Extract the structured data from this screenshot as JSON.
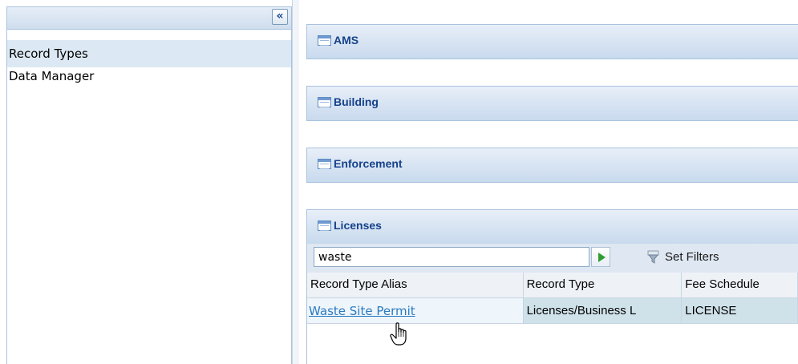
{
  "sidebar": {
    "collapse_glyph": "«",
    "items": [
      {
        "label": "Record Types",
        "selected": true
      },
      {
        "label": "Data Manager",
        "selected": false
      }
    ]
  },
  "sections": [
    {
      "title": "AMS",
      "icon": "panel-icon"
    },
    {
      "title": "Building",
      "icon": "panel-icon"
    },
    {
      "title": "Enforcement",
      "icon": "panel-icon"
    },
    {
      "title": "Licenses",
      "icon": "panel-icon"
    }
  ],
  "licenses": {
    "search_value": "waste",
    "go_icon": "play-arrow-icon",
    "filter_icon": "filter-icon",
    "set_filters_label": "Set Filters",
    "columns": [
      "Record Type Alias",
      "Record Type",
      "Fee Schedule"
    ],
    "rows": [
      [
        "Waste Site Permit",
        "Licenses/Business L",
        "LICENSE"
      ]
    ]
  },
  "colors": {
    "header_text": "#15428b",
    "link": "#2b7bc1",
    "selected_row": "#cfe2ea"
  }
}
